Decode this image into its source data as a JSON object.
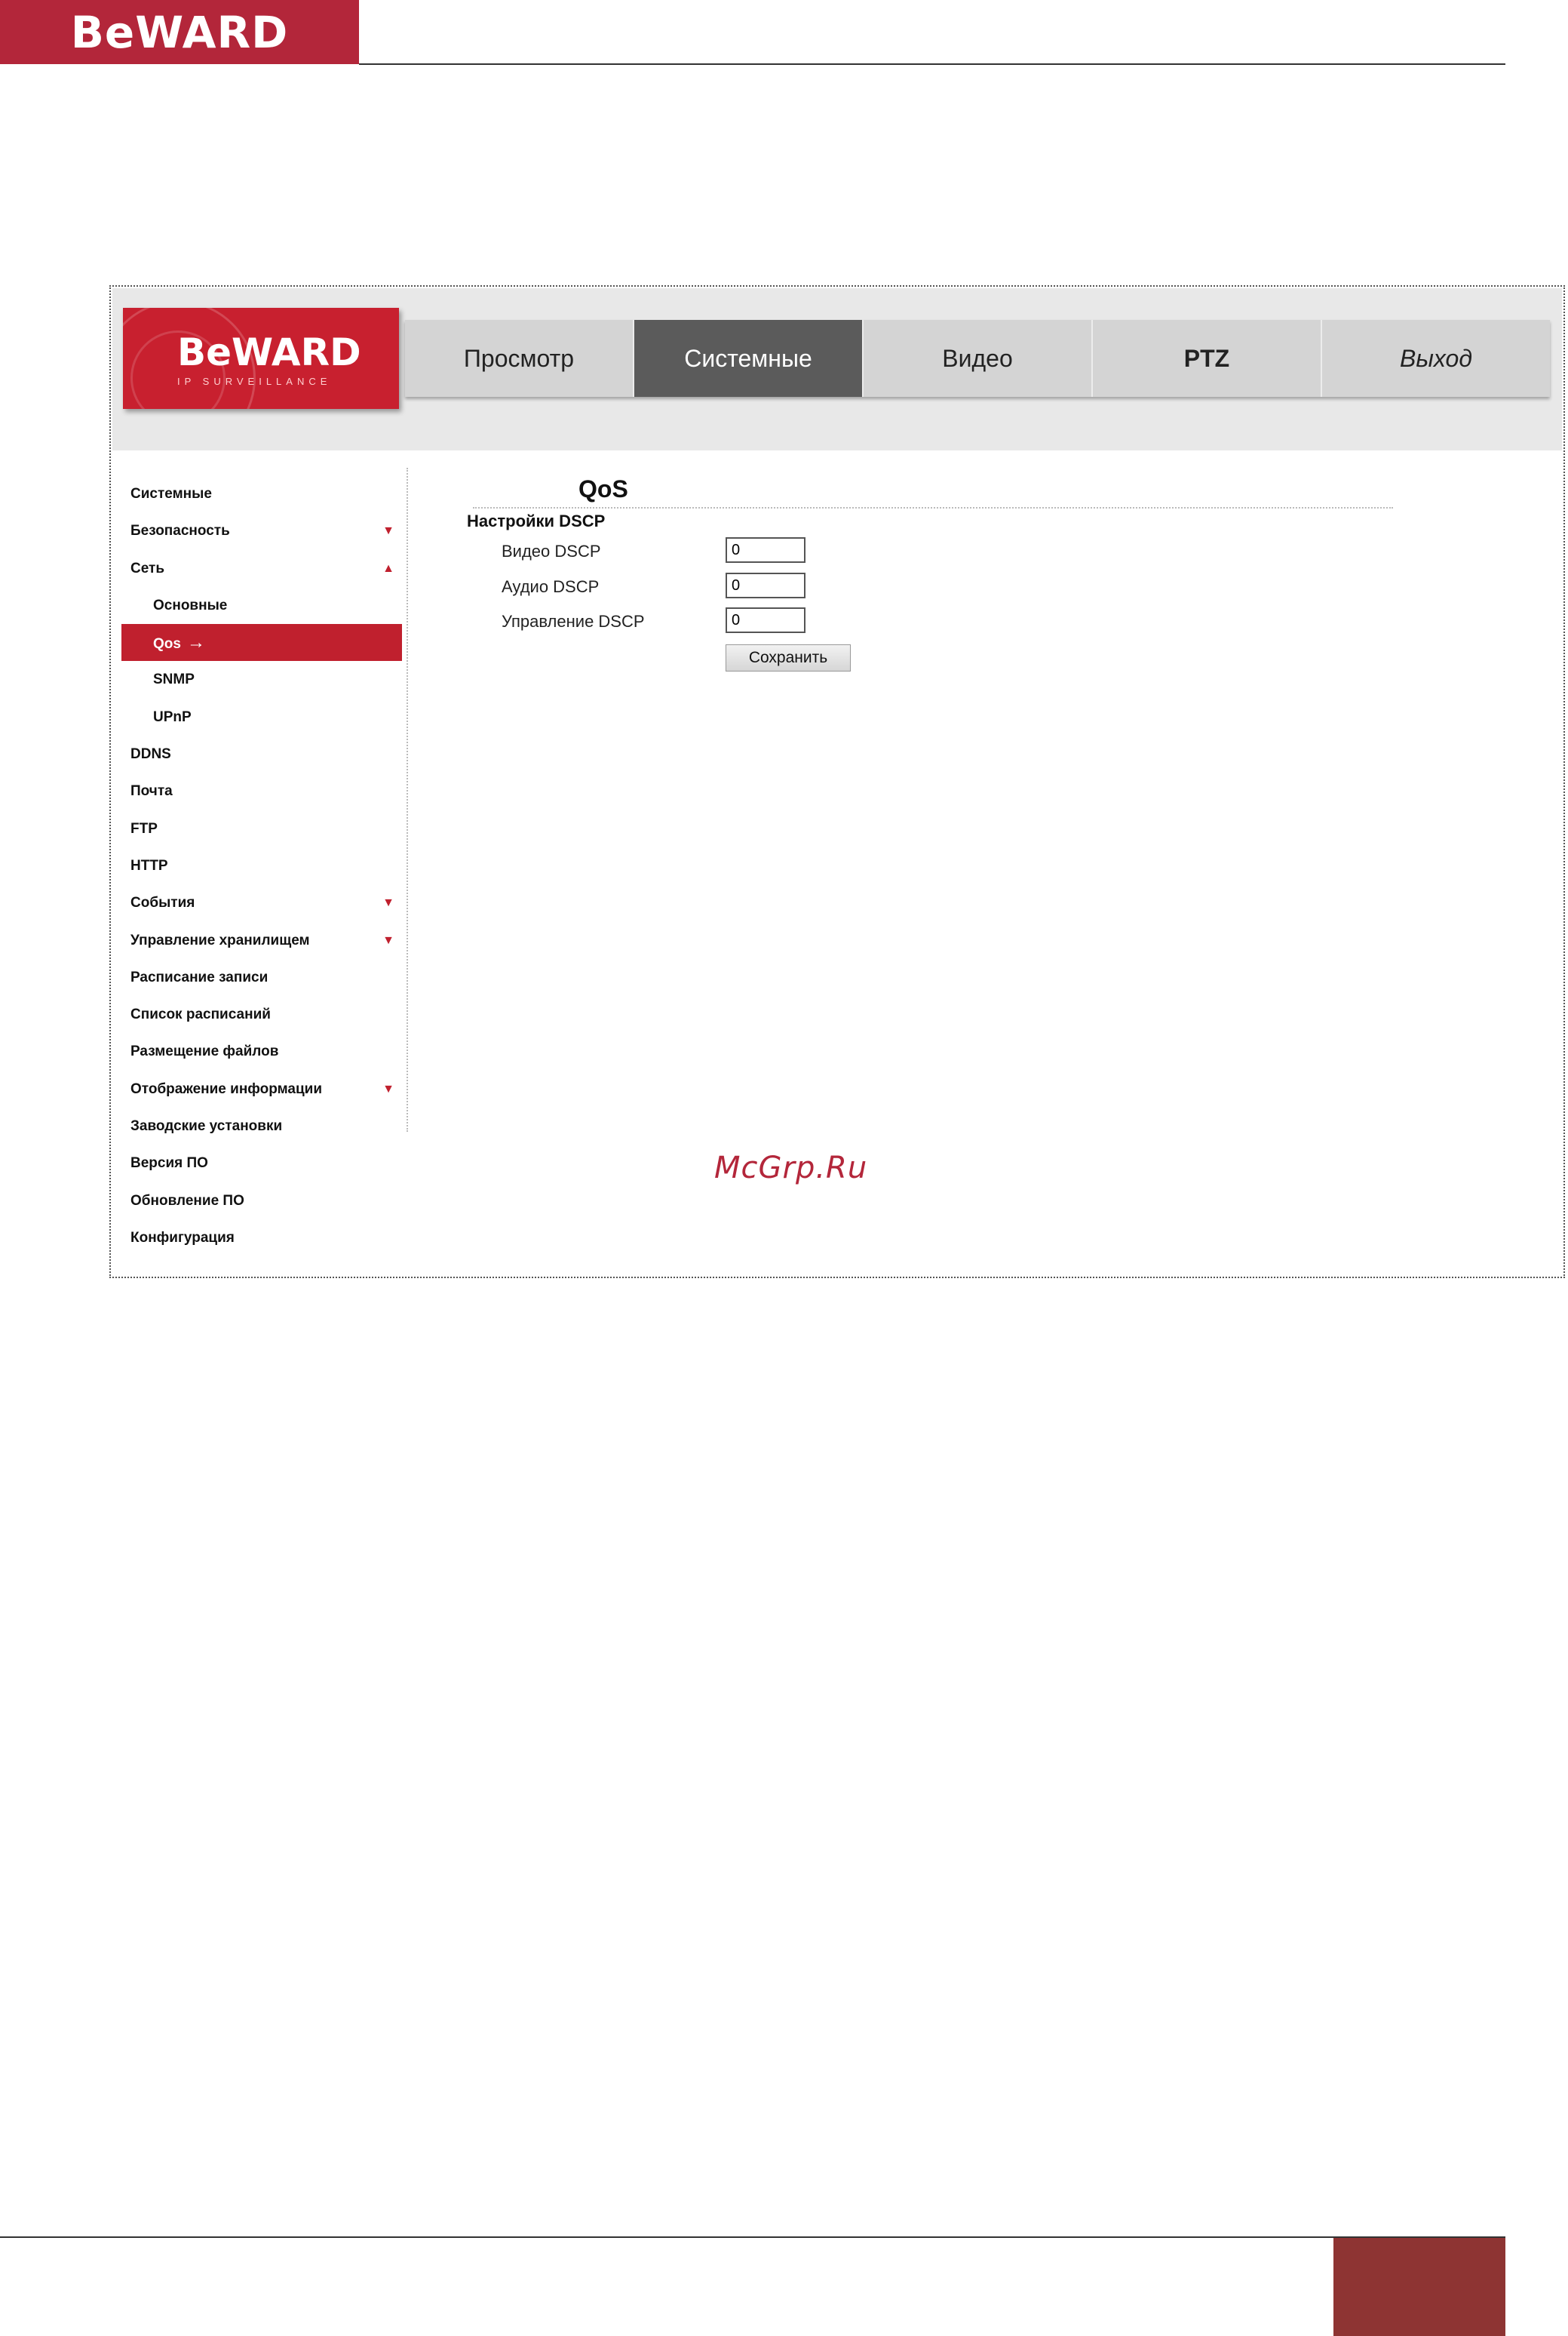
{
  "page_header": {
    "logo_text": "BeWARD"
  },
  "app": {
    "logo": {
      "brand": "BeWARD",
      "tagline": "IP SURVEILLANCE"
    },
    "tabs": [
      {
        "label": "Просмотр",
        "active": false
      },
      {
        "label": "Системные",
        "active": true
      },
      {
        "label": "Видео",
        "active": false
      },
      {
        "label": "PTZ",
        "active": false
      },
      {
        "label": "Выход",
        "active": false
      }
    ]
  },
  "sidebar": {
    "items": [
      {
        "label": "Системные"
      },
      {
        "label": "Безопасность",
        "arrow": "▼"
      },
      {
        "label": "Сеть",
        "arrow": "▲"
      },
      {
        "label": "Основные",
        "sub": true
      },
      {
        "label": "Qos",
        "sub": true,
        "active": true,
        "suffix": "→"
      },
      {
        "label": "SNMP",
        "sub": true
      },
      {
        "label": "UPnP",
        "sub": true
      },
      {
        "label": "DDNS"
      },
      {
        "label": "Почта"
      },
      {
        "label": "FTP"
      },
      {
        "label": "HTTP"
      },
      {
        "label": "События",
        "arrow": "▼"
      },
      {
        "label": "Управление хранилищем",
        "arrow": "▼"
      },
      {
        "label": "Расписание записи"
      },
      {
        "label": "Список расписаний"
      },
      {
        "label": "Размещение файлов"
      },
      {
        "label": "Отображение информации",
        "arrow": "▼"
      },
      {
        "label": "Заводские установки"
      },
      {
        "label": "Версия ПО"
      },
      {
        "label": "Обновление ПО"
      },
      {
        "label": "Конфигурация"
      }
    ]
  },
  "content": {
    "title": "QoS",
    "section_title": "Настройки DSCP",
    "fields": [
      {
        "label": "Видео DSCP",
        "value": "0"
      },
      {
        "label": "Аудио DSCP",
        "value": "0"
      },
      {
        "label": "Управление DSCP",
        "value": "0"
      }
    ],
    "save_label": "Сохранить"
  },
  "watermark": "McGrp.Ru"
}
